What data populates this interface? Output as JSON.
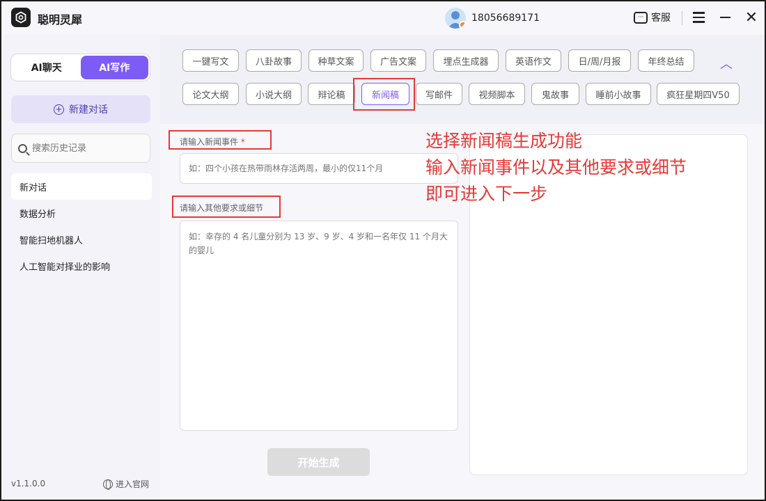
{
  "titlebar": {
    "app_name": "聪明灵犀",
    "phone": "18056689171",
    "service_label": "客服"
  },
  "sidebar": {
    "modes": [
      "AI聊天",
      "AI写作"
    ],
    "active_mode": "AI写作",
    "new_chat_label": "新建对话",
    "search_placeholder": "搜索历史记录",
    "history": [
      "新对话",
      "数据分析",
      "智能扫地机器人",
      "人工智能对择业的影响"
    ],
    "version": "v1.1.0.0",
    "official_site_label": "进入官网"
  },
  "main": {
    "templates_row1": [
      "一键写文",
      "八卦故事",
      "种草文案",
      "广告文案",
      "埋点生成器",
      "英语作文",
      "日/周/月报",
      "年终总结"
    ],
    "templates_row2": [
      "论文大纲",
      "小说大纲",
      "辩论稿",
      "新闻稿",
      "写邮件",
      "视频脚本",
      "鬼故事",
      "睡前小故事",
      "疯狂星期四V50"
    ],
    "selected_template": "新闻稿",
    "news_event_label": "请输入新闻事件",
    "required_mark": "*",
    "news_event_placeholder": "如：四个小孩在热带雨林存活两周，最小的仅11个月",
    "details_label": "请输入其他要求或细节",
    "details_placeholder": "如：幸存的 4 名儿童分别为 13 岁、9 岁、4 岁和一名年仅 11 个月大的婴儿",
    "generate_label": "开始生成"
  },
  "annotation": {
    "lines": [
      "选择新闻稿生成功能",
      "输入新闻事件以及其他要求或细节",
      "即可进入下一步"
    ]
  },
  "colors": {
    "accent": "#7d5cf5",
    "annotation_red": "#e53935"
  }
}
